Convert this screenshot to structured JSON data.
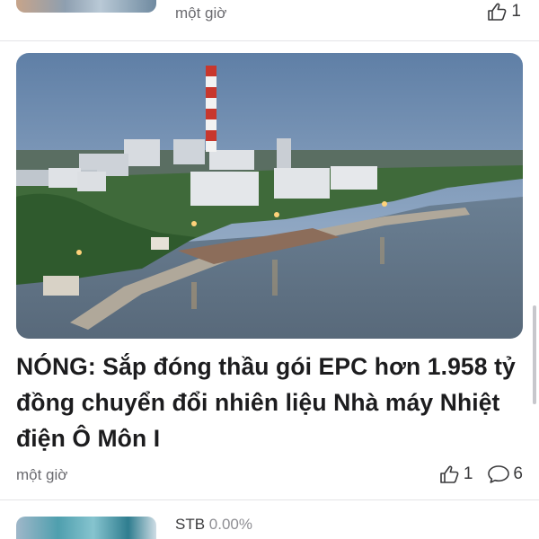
{
  "previous_item": {
    "time": "một giờ",
    "likes": "1"
  },
  "article": {
    "headline": "NÓNG: Sắp đóng thầu gói EPC hơn 1.958 tỷ đồng chuyển đổi nhiên liệu Nhà máy Nhiệt điện Ô Môn I",
    "time": "một giờ",
    "likes": "1",
    "comments": "6",
    "image": "power-plant-riverside-photo"
  },
  "next_item": {
    "ticker": "STB",
    "change": "0.00%"
  },
  "icons": {
    "like": "thumbs-up-icon",
    "comment": "comment-bubble-icon"
  },
  "colors": {
    "text_primary": "#1c1c1e",
    "text_secondary": "#6b6b70",
    "divider": "#e4e4e7"
  }
}
